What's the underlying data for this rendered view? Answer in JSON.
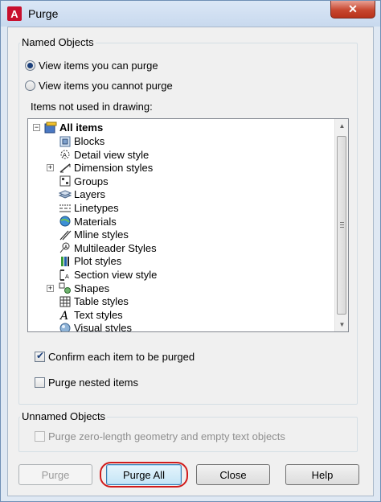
{
  "window": {
    "title": "Purge",
    "close_glyph": "✕"
  },
  "named_objects": {
    "label": "Named Objects",
    "radio_can_purge": "View items you can purge",
    "radio_cannot_purge": "View items you cannot purge",
    "selected_radio": "can_purge",
    "list_label": "Items not used in drawing:"
  },
  "tree": {
    "root": {
      "label": "All items",
      "expander": "−"
    },
    "items": [
      {
        "label": "Blocks",
        "icon": "blocks-icon",
        "expander": ""
      },
      {
        "label": "Detail view style",
        "icon": "detail-view-style-icon",
        "expander": ""
      },
      {
        "label": "Dimension styles",
        "icon": "dimension-styles-icon",
        "expander": "+"
      },
      {
        "label": "Groups",
        "icon": "groups-icon",
        "expander": ""
      },
      {
        "label": "Layers",
        "icon": "layers-icon",
        "expander": ""
      },
      {
        "label": "Linetypes",
        "icon": "linetypes-icon",
        "expander": ""
      },
      {
        "label": "Materials",
        "icon": "materials-icon",
        "expander": ""
      },
      {
        "label": "Mline styles",
        "icon": "mline-styles-icon",
        "expander": ""
      },
      {
        "label": "Multileader Styles",
        "icon": "multileader-styles-icon",
        "expander": ""
      },
      {
        "label": "Plot styles",
        "icon": "plot-styles-icon",
        "expander": ""
      },
      {
        "label": "Section view style",
        "icon": "section-view-style-icon",
        "expander": ""
      },
      {
        "label": "Shapes",
        "icon": "shapes-icon",
        "expander": "+"
      },
      {
        "label": "Table styles",
        "icon": "table-styles-icon",
        "expander": ""
      },
      {
        "label": "Text styles",
        "icon": "text-styles-icon",
        "expander": ""
      },
      {
        "label": "Visual styles",
        "icon": "visual-styles-icon",
        "expander": ""
      }
    ]
  },
  "options": {
    "confirm_each": "Confirm each item to be purged",
    "confirm_checked": true,
    "purge_nested": "Purge nested items",
    "nested_checked": false
  },
  "unnamed_objects": {
    "label": "Unnamed Objects",
    "zero_length": "Purge zero-length geometry and empty text objects",
    "zero_length_checked": false
  },
  "buttons": {
    "purge": "Purge",
    "purge_all": "Purge All",
    "close": "Close",
    "help": "Help"
  },
  "colors": {
    "accent": "#3c7fb1",
    "annotation_ring": "#d01c1c",
    "close_button": "#c7472f"
  }
}
